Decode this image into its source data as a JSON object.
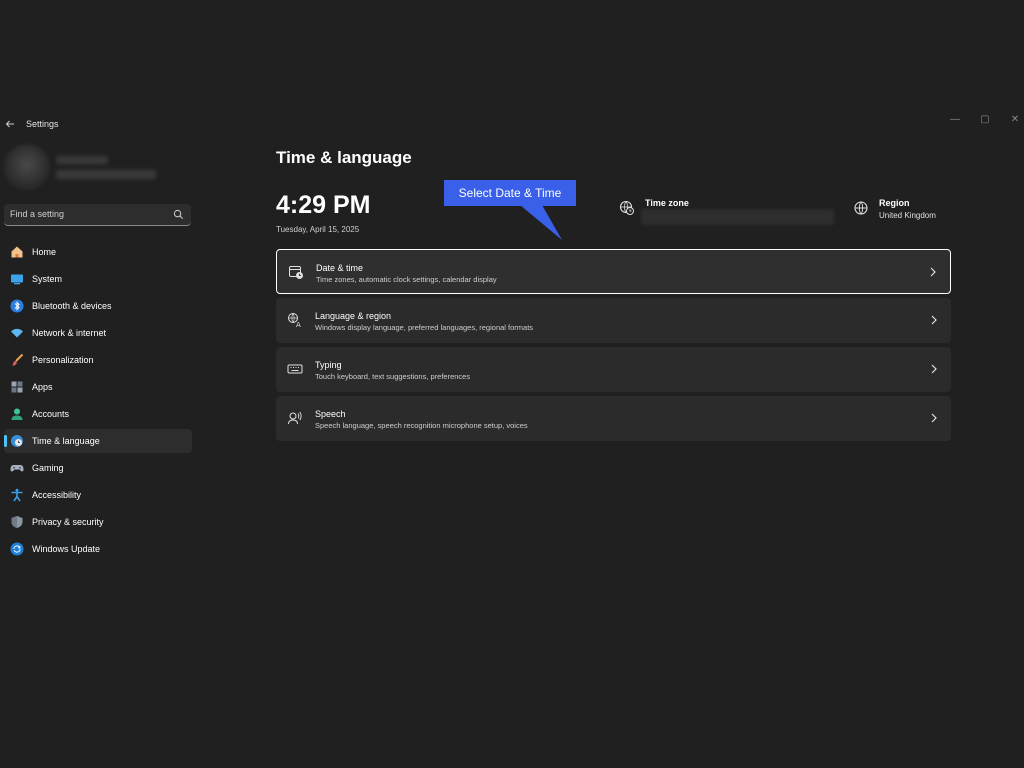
{
  "window": {
    "title": "Settings",
    "minimize": "—",
    "maximize": "▢",
    "close": "✕"
  },
  "search": {
    "placeholder": "Find a setting"
  },
  "sidebar": {
    "items": [
      {
        "label": "Home",
        "icon": "home-icon",
        "selected": false
      },
      {
        "label": "System",
        "icon": "system-icon",
        "selected": false
      },
      {
        "label": "Bluetooth & devices",
        "icon": "bluetooth-icon",
        "selected": false
      },
      {
        "label": "Network & internet",
        "icon": "wifi-icon",
        "selected": false
      },
      {
        "label": "Personalization",
        "icon": "brush-icon",
        "selected": false
      },
      {
        "label": "Apps",
        "icon": "apps-icon",
        "selected": false
      },
      {
        "label": "Accounts",
        "icon": "person-icon",
        "selected": false
      },
      {
        "label": "Time & language",
        "icon": "globe-clock-icon",
        "selected": true
      },
      {
        "label": "Gaming",
        "icon": "gamepad-icon",
        "selected": false
      },
      {
        "label": "Accessibility",
        "icon": "accessibility-icon",
        "selected": false
      },
      {
        "label": "Privacy & security",
        "icon": "shield-icon",
        "selected": false
      },
      {
        "label": "Windows Update",
        "icon": "update-icon",
        "selected": false
      }
    ]
  },
  "main": {
    "title": "Time & language",
    "clock": "4:29 PM",
    "date": "Tuesday, April 15, 2025",
    "time_zone_label": "Time zone",
    "region_label": "Region",
    "region_value": "United Kingdom",
    "cards": [
      {
        "title": "Date & time",
        "description": "Time zones, automatic clock settings, calendar display",
        "icon": "calendar-clock-icon"
      },
      {
        "title": "Language & region",
        "description": "Windows display language, preferred languages, regional formats",
        "icon": "language-icon"
      },
      {
        "title": "Typing",
        "description": "Touch keyboard, text suggestions, preferences",
        "icon": "keyboard-icon"
      },
      {
        "title": "Speech",
        "description": "Speech language, speech recognition microphone setup, voices",
        "icon": "speech-icon"
      }
    ]
  },
  "callout": {
    "text": "Select Date & Time"
  },
  "colors": {
    "background": "#202020",
    "accent": "#4cc2ff",
    "callout": "#3a5fe8"
  }
}
